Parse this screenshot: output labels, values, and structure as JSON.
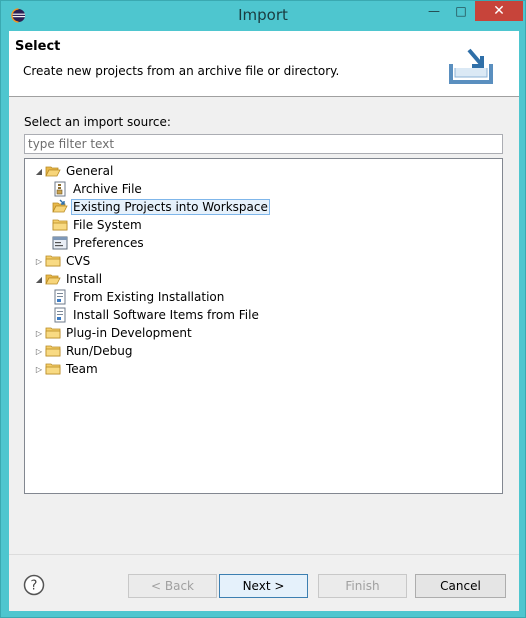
{
  "window": {
    "title": "Import",
    "controls": {
      "minimize": "—",
      "maximize": "□",
      "close": "✕"
    }
  },
  "banner": {
    "title": "Select",
    "description": "Create new projects from an archive file or directory."
  },
  "source": {
    "label": "Select an import source:",
    "filter_placeholder": "type filter text",
    "filter_value": ""
  },
  "tree": [
    {
      "label": "General",
      "level": 0,
      "expanded": true,
      "icon": "folder-open-icon"
    },
    {
      "label": "Archive File",
      "level": 1,
      "icon": "archive-file-icon"
    },
    {
      "label": "Existing Projects into Workspace",
      "level": 1,
      "icon": "project-folder-icon",
      "selected": true
    },
    {
      "label": "File System",
      "level": 1,
      "icon": "folder-icon"
    },
    {
      "label": "Preferences",
      "level": 1,
      "icon": "preferences-icon"
    },
    {
      "label": "CVS",
      "level": 0,
      "expanded": false,
      "icon": "folder-icon"
    },
    {
      "label": "Install",
      "level": 0,
      "expanded": true,
      "icon": "folder-open-icon"
    },
    {
      "label": "From Existing Installation",
      "level": 1,
      "icon": "installation-icon"
    },
    {
      "label": "Install Software Items from File",
      "level": 1,
      "icon": "installation-icon"
    },
    {
      "label": "Plug-in Development",
      "level": 0,
      "expanded": false,
      "icon": "folder-icon"
    },
    {
      "label": "Run/Debug",
      "level": 0,
      "expanded": false,
      "icon": "folder-icon"
    },
    {
      "label": "Team",
      "level": 0,
      "expanded": false,
      "icon": "folder-icon"
    }
  ],
  "buttons": {
    "help": "?",
    "back": "< Back",
    "next": "Next >",
    "finish": "Finish",
    "cancel": "Cancel"
  },
  "colors": {
    "window_frame": "#4ec6cf",
    "close_button": "#c7443a",
    "selection": "#e6f1fb"
  }
}
